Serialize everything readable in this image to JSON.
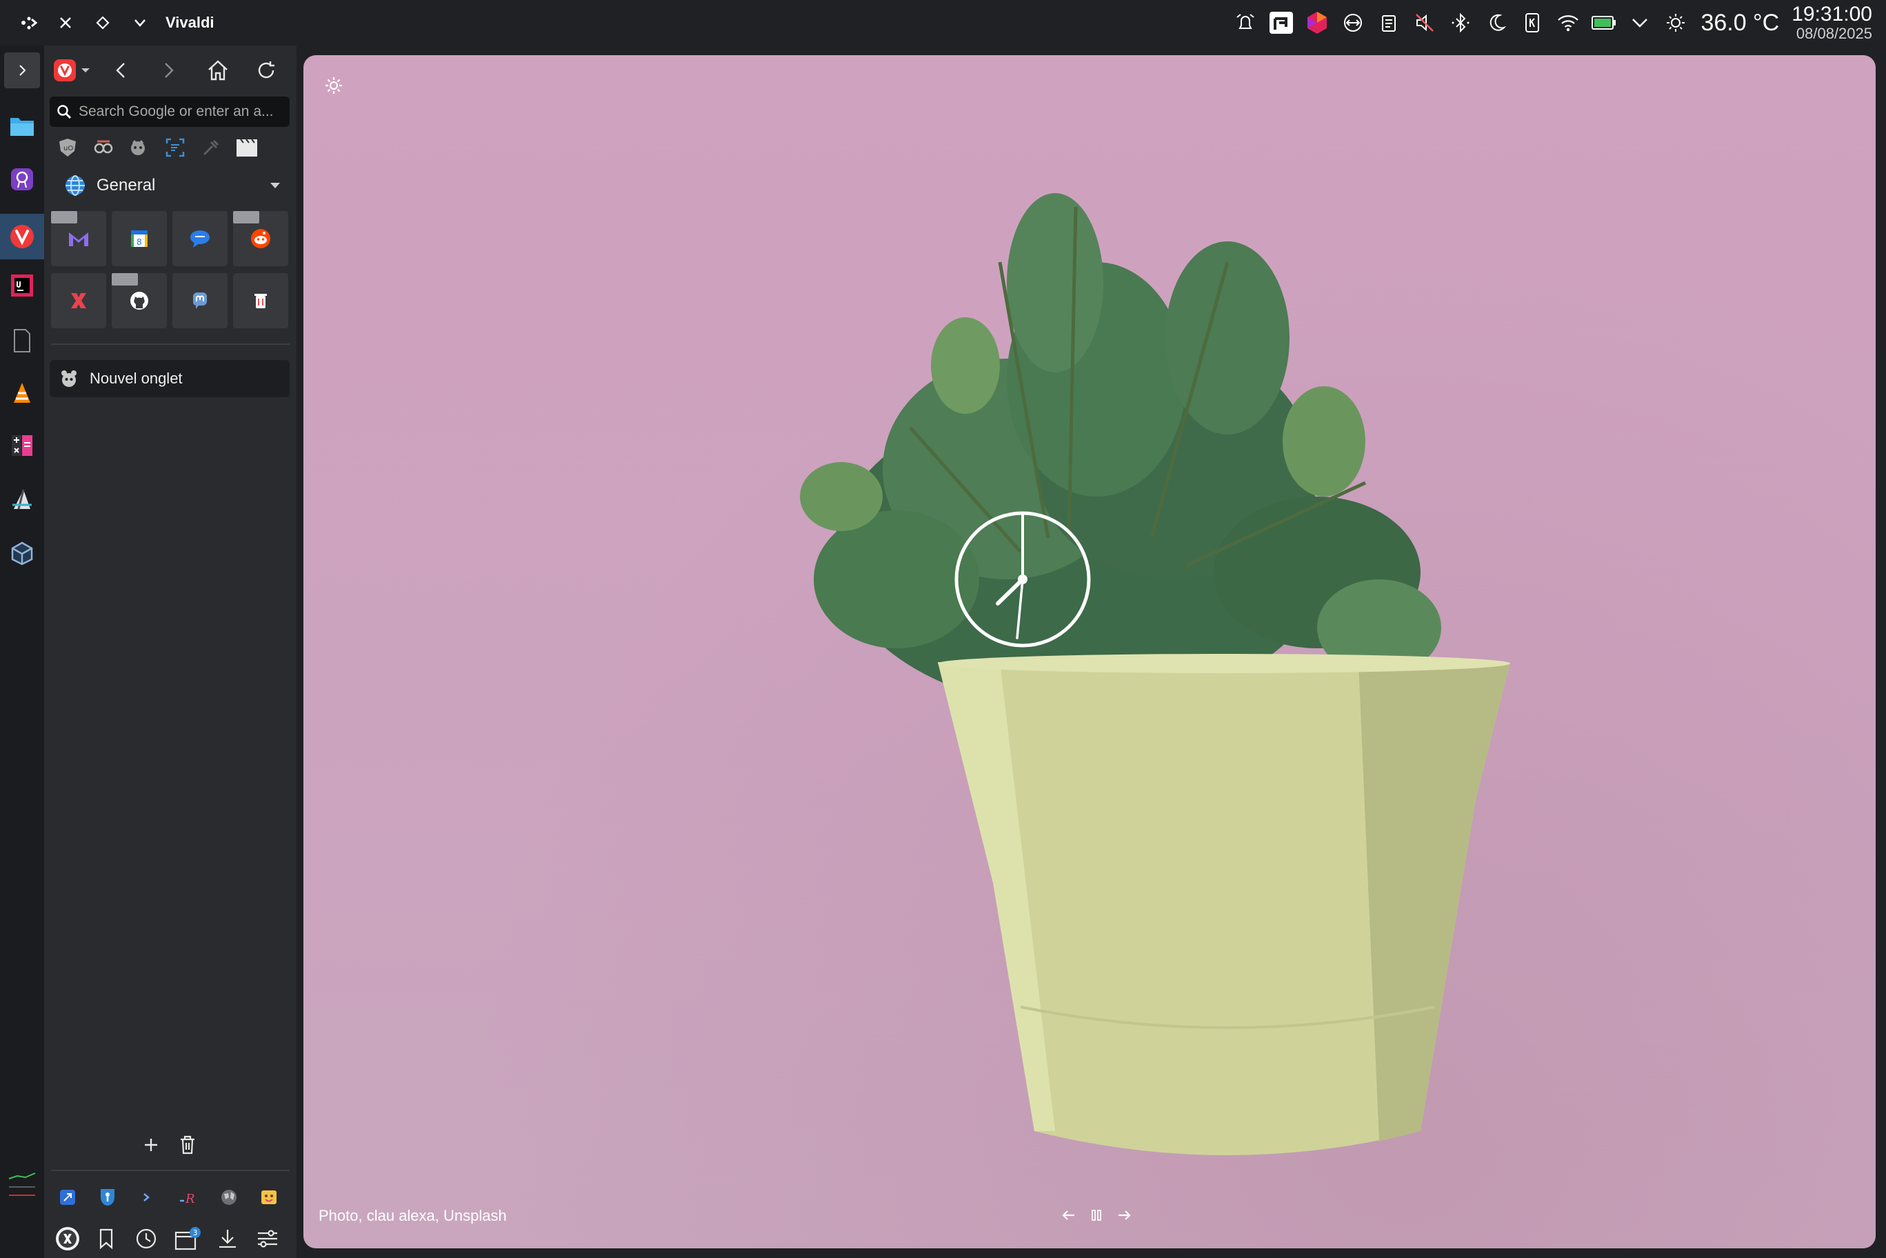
{
  "window": {
    "title": "Vivaldi"
  },
  "tray": {
    "temperature": "36.0 °C",
    "time": "19:31:00",
    "date": "08/08/2025"
  },
  "panel": {
    "search_placeholder": "Search Google or enter an a...",
    "workspace_name": "General",
    "speed_dial": [
      {
        "icon": "mail-icon",
        "color": "#8e6ee8"
      },
      {
        "icon": "calendar-icon",
        "color": "#1a73e8"
      },
      {
        "icon": "chat-bubble-icon",
        "color": "#2b7de9"
      },
      {
        "icon": "reddit-icon",
        "color": "#ff4500"
      },
      {
        "icon": "kagi-icon",
        "color": "#e8434f"
      },
      {
        "icon": "github-icon",
        "color": "#ffffff"
      },
      {
        "icon": "mastodon-icon",
        "color": "#6c9bd2"
      },
      {
        "icon": "trash-bin-icon",
        "color": "#e25555"
      }
    ],
    "tabs": [
      {
        "label": "Nouvel onglet"
      }
    ]
  },
  "start_page": {
    "photo_credit": "Photo, clau alexa, Unsplash"
  },
  "colors": {
    "vivaldi_red": "#ef3939",
    "panel_bg": "#2a2b2e",
    "background_pink": "#cfa2bf"
  }
}
